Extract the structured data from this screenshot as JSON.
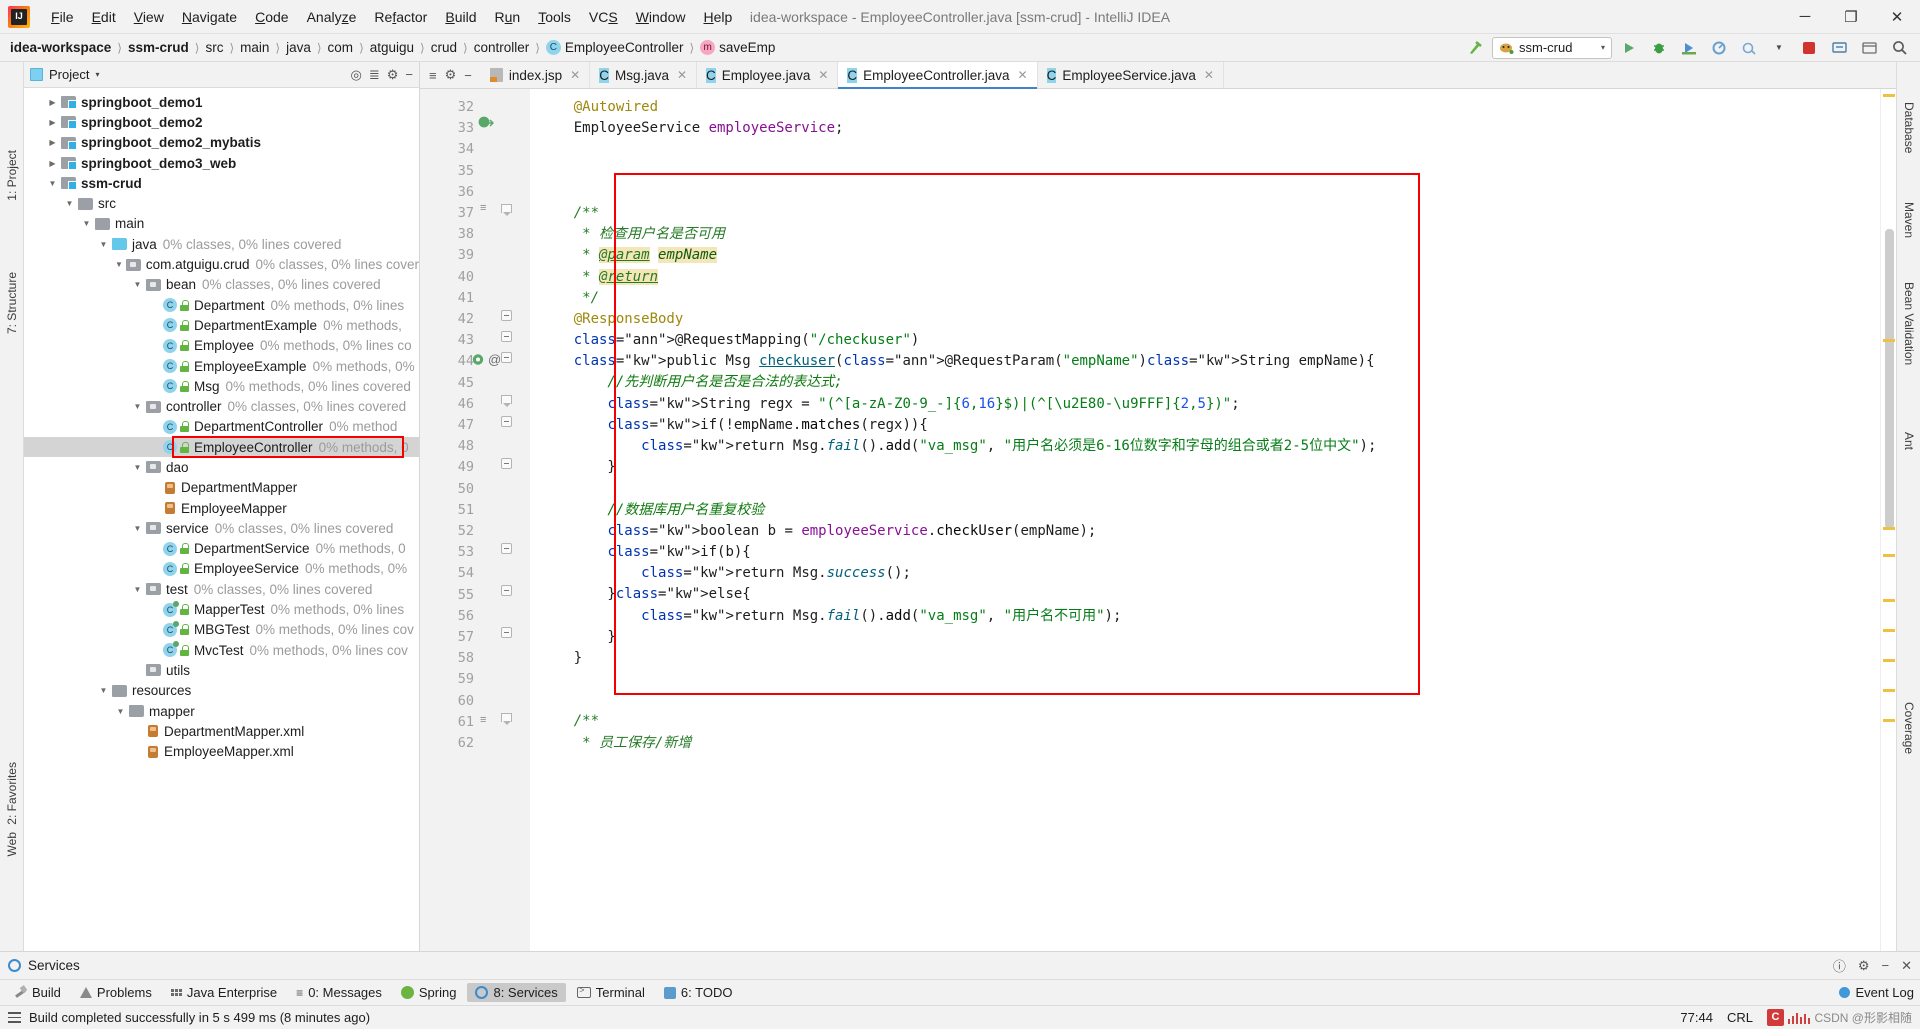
{
  "window": {
    "title": "idea-workspace - EmployeeController.java [ssm-crud] - IntelliJ IDEA",
    "minimize": "─",
    "maximize": "❐",
    "close": "✕"
  },
  "menu": [
    {
      "label": "File"
    },
    {
      "label": "Edit"
    },
    {
      "label": "View"
    },
    {
      "label": "Navigate"
    },
    {
      "label": "Code"
    },
    {
      "label": "Analyze"
    },
    {
      "label": "Refactor"
    },
    {
      "label": "Build"
    },
    {
      "label": "Run"
    },
    {
      "label": "Tools"
    },
    {
      "label": "VCS"
    },
    {
      "label": "Window"
    },
    {
      "label": "Help"
    }
  ],
  "breadcrumb": [
    {
      "label": "idea-workspace",
      "bold": true
    },
    {
      "label": "ssm-crud",
      "bold": true
    },
    {
      "label": "src"
    },
    {
      "label": "main"
    },
    {
      "label": "java"
    },
    {
      "label": "com"
    },
    {
      "label": "atguigu"
    },
    {
      "label": "crud"
    },
    {
      "label": "controller"
    },
    {
      "label": "EmployeeController",
      "icon": "class-icon"
    },
    {
      "label": "saveEmp",
      "icon": "method-icon"
    }
  ],
  "toolbar": {
    "run_config": "ssm-crud",
    "run_config_caret": "▾",
    "hammer_icon": "build-hammer-icon",
    "buttons": [
      "run-icon",
      "debug-icon",
      "coverage-icon",
      "profile-icon",
      "attach-icon",
      "stop-icon",
      "update-icon",
      "settings-icon",
      "search-icon"
    ]
  },
  "project_panel": {
    "title": "Project",
    "title_caret": "▾",
    "actions": [
      "target-icon",
      "collapse-icon",
      "settings-gear-icon",
      "hide-icon"
    ],
    "tree": [
      {
        "indent": 1,
        "arrow": "▶",
        "icon": "module-folder",
        "label": "springboot_demo1",
        "bold": true,
        "coverage": ""
      },
      {
        "indent": 1,
        "arrow": "▶",
        "icon": "module-folder",
        "label": "springboot_demo2",
        "bold": true,
        "coverage": ""
      },
      {
        "indent": 1,
        "arrow": "▶",
        "icon": "module-folder",
        "label": "springboot_demo2_mybatis",
        "bold": true,
        "coverage": ""
      },
      {
        "indent": 1,
        "arrow": "▶",
        "icon": "module-folder",
        "label": "springboot_demo3_web",
        "bold": true,
        "coverage": ""
      },
      {
        "indent": 1,
        "arrow": "▼",
        "icon": "module-folder",
        "label": "ssm-crud",
        "bold": true,
        "coverage": ""
      },
      {
        "indent": 2,
        "arrow": "▼",
        "icon": "folder",
        "label": "src",
        "coverage": ""
      },
      {
        "indent": 3,
        "arrow": "▼",
        "icon": "folder",
        "label": "main",
        "coverage": ""
      },
      {
        "indent": 4,
        "arrow": "▼",
        "icon": "source-folder",
        "label": "java",
        "coverage": "0% classes, 0% lines covered"
      },
      {
        "indent": 5,
        "arrow": "▼",
        "icon": "package",
        "label": "com.atguigu.crud",
        "coverage": "0% classes, 0% lines covere"
      },
      {
        "indent": 6,
        "arrow": "▼",
        "icon": "package",
        "label": "bean",
        "coverage": "0% classes, 0% lines covered"
      },
      {
        "indent": 7,
        "arrow": "",
        "icon": "class",
        "label": "Department",
        "coverage": "0% methods, 0% lines"
      },
      {
        "indent": 7,
        "arrow": "",
        "icon": "class",
        "label": "DepartmentExample",
        "coverage": "0% methods,"
      },
      {
        "indent": 7,
        "arrow": "",
        "icon": "class",
        "label": "Employee",
        "coverage": "0% methods, 0% lines co"
      },
      {
        "indent": 7,
        "arrow": "",
        "icon": "class",
        "label": "EmployeeExample",
        "coverage": "0% methods, 0%"
      },
      {
        "indent": 7,
        "arrow": "",
        "icon": "class",
        "label": "Msg",
        "coverage": "0% methods, 0% lines covered"
      },
      {
        "indent": 6,
        "arrow": "▼",
        "icon": "package",
        "label": "controller",
        "coverage": "0% classes, 0% lines covered"
      },
      {
        "indent": 7,
        "arrow": "",
        "icon": "class",
        "label": "DepartmentController",
        "coverage": "0% method"
      },
      {
        "indent": 7,
        "arrow": "",
        "icon": "class",
        "label": "EmployeeController",
        "coverage": "0% methods, 0",
        "selected": true,
        "highlighted": true
      },
      {
        "indent": 6,
        "arrow": "▼",
        "icon": "package",
        "label": "dao",
        "coverage": ""
      },
      {
        "indent": 7,
        "arrow": "",
        "icon": "mapper",
        "label": "DepartmentMapper",
        "coverage": ""
      },
      {
        "indent": 7,
        "arrow": "",
        "icon": "mapper",
        "label": "EmployeeMapper",
        "coverage": ""
      },
      {
        "indent": 6,
        "arrow": "▼",
        "icon": "package",
        "label": "service",
        "coverage": "0% classes, 0% lines covered"
      },
      {
        "indent": 7,
        "arrow": "",
        "icon": "class",
        "label": "DepartmentService",
        "coverage": "0% methods, 0"
      },
      {
        "indent": 7,
        "arrow": "",
        "icon": "class",
        "label": "EmployeeService",
        "coverage": "0% methods, 0%"
      },
      {
        "indent": 6,
        "arrow": "▼",
        "icon": "package",
        "label": "test",
        "coverage": "0% classes, 0% lines covered"
      },
      {
        "indent": 7,
        "arrow": "",
        "icon": "test-class",
        "label": "MapperTest",
        "coverage": "0% methods, 0% lines"
      },
      {
        "indent": 7,
        "arrow": "",
        "icon": "test-class",
        "label": "MBGTest",
        "coverage": "0% methods, 0% lines cov"
      },
      {
        "indent": 7,
        "arrow": "",
        "icon": "test-class",
        "label": "MvcTest",
        "coverage": "0% methods, 0% lines cov"
      },
      {
        "indent": 6,
        "arrow": "",
        "icon": "package",
        "label": "utils",
        "coverage": ""
      },
      {
        "indent": 4,
        "arrow": "▼",
        "icon": "resource-folder",
        "label": "resources",
        "coverage": ""
      },
      {
        "indent": 5,
        "arrow": "▼",
        "icon": "folder",
        "label": "mapper",
        "coverage": ""
      },
      {
        "indent": 6,
        "arrow": "",
        "icon": "xml",
        "label": "DepartmentMapper.xml",
        "coverage": ""
      },
      {
        "indent": 6,
        "arrow": "",
        "icon": "xml",
        "label": "EmployeeMapper.xml",
        "coverage": ""
      }
    ]
  },
  "editor_tabs": [
    {
      "label": "index.jsp",
      "icon": "jsp-icon",
      "active": false
    },
    {
      "label": "Msg.java",
      "icon": "class-icon",
      "active": false
    },
    {
      "label": "Employee.java",
      "icon": "class-icon",
      "active": false
    },
    {
      "label": "EmployeeController.java",
      "icon": "class-icon",
      "active": true
    },
    {
      "label": "EmployeeService.java",
      "icon": "class-icon",
      "active": false
    }
  ],
  "code": {
    "first_line": 32,
    "lines": [
      {
        "n": 32,
        "text": "    @Autowired"
      },
      {
        "n": 33,
        "text": "    EmployeeService employeeService;"
      },
      {
        "n": 34,
        "text": ""
      },
      {
        "n": 35,
        "text": ""
      },
      {
        "n": 36,
        "text": ""
      },
      {
        "n": 37,
        "text": "    /**"
      },
      {
        "n": 38,
        "text": "     * 检查用户名是否可用"
      },
      {
        "n": 39,
        "text": "     * @param empName"
      },
      {
        "n": 40,
        "text": "     * @return"
      },
      {
        "n": 41,
        "text": "     */"
      },
      {
        "n": 42,
        "text": "    @ResponseBody"
      },
      {
        "n": 43,
        "text": "    @RequestMapping(\"/checkuser\")"
      },
      {
        "n": 44,
        "text": "    public Msg checkuser(@RequestParam(\"empName\")String empName){"
      },
      {
        "n": 45,
        "text": "        //先判断用户名是否是合法的表达式;"
      },
      {
        "n": 46,
        "text": "        String regx = \"(^[a-zA-Z0-9_-]{6,16}$)|(^[\\u2E80-\\u9FFF]{2,5})\";"
      },
      {
        "n": 47,
        "text": "        if(!empName.matches(regx)){"
      },
      {
        "n": 48,
        "text": "            return Msg.fail().add(\"va_msg\", \"用户名必须是6-16位数字和字母的组合或者2-5位中文\");"
      },
      {
        "n": 49,
        "text": "        }"
      },
      {
        "n": 50,
        "text": ""
      },
      {
        "n": 51,
        "text": "        //数据库用户名重复校验"
      },
      {
        "n": 52,
        "text": "        boolean b = employeeService.checkUser(empName);"
      },
      {
        "n": 53,
        "text": "        if(b){"
      },
      {
        "n": 54,
        "text": "            return Msg.success();"
      },
      {
        "n": 55,
        "text": "        }else{"
      },
      {
        "n": 56,
        "text": "            return Msg.fail().add(\"va_msg\", \"用户名不可用\");"
      },
      {
        "n": 57,
        "text": "        }"
      },
      {
        "n": 58,
        "text": "    }"
      },
      {
        "n": 59,
        "text": ""
      },
      {
        "n": 60,
        "text": ""
      },
      {
        "n": 61,
        "text": "    /**"
      },
      {
        "n": 62,
        "text": "     * 员工保存/新增"
      }
    ]
  },
  "bottom": {
    "services_title": "Services",
    "tool_buttons": [
      {
        "label": "Build",
        "icon": "build-icon",
        "active": false
      },
      {
        "label": "Problems",
        "icon": "problems-icon",
        "active": false
      },
      {
        "label": "Java Enterprise",
        "icon": "java-enterprise-icon",
        "active": false
      },
      {
        "label": "0: Messages",
        "icon": "messages-icon",
        "active": false
      },
      {
        "label": "Spring",
        "icon": "spring-icon",
        "active": false
      },
      {
        "label": "8: Services",
        "icon": "services-icon",
        "active": true
      },
      {
        "label": "Terminal",
        "icon": "terminal-icon",
        "active": false
      },
      {
        "label": "6: TODO",
        "icon": "todo-icon",
        "active": false
      }
    ],
    "event_log": "Event Log"
  },
  "status_bar": {
    "message": "Build completed successfully in 5 s 499 ms (8 minutes ago)",
    "caret_position": "77:44",
    "line_separator": "CRL",
    "watermark": "CSDN @形影相随"
  },
  "side_tabs": {
    "left": [
      {
        "label": "1: Project"
      },
      {
        "label": "7: Structure"
      },
      {
        "label": "2: Favorites"
      },
      {
        "label": "Web"
      }
    ],
    "right": [
      {
        "label": "Database"
      },
      {
        "label": "Maven"
      },
      {
        "label": "Ant"
      },
      {
        "label": "Bean Validation"
      },
      {
        "label": "Coverage"
      }
    ]
  }
}
